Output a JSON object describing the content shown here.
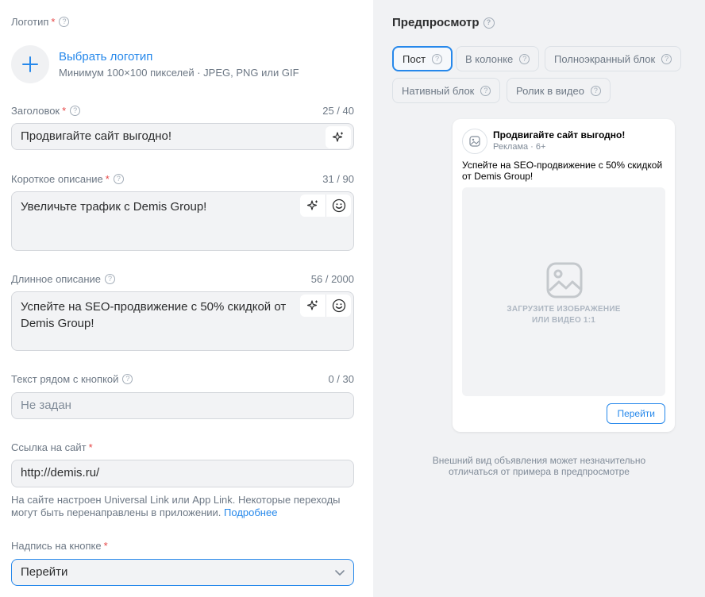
{
  "logo": {
    "label": "Логотип",
    "link": "Выбрать логотип",
    "hint": "Минимум 100×100 пикселей · JPEG, PNG или GIF"
  },
  "headline": {
    "label": "Заголовок",
    "counter": "25 / 40",
    "value": "Продвигайте сайт выгодно!"
  },
  "short_desc": {
    "label": "Короткое описание",
    "counter": "31 / 90",
    "value": "Увеличьте трафик с Demis Group!"
  },
  "long_desc": {
    "label": "Длинное описание",
    "counter": "56 / 2000",
    "value": "Успейте на SEO-продвижение с 50% скидкой от Demis Group!"
  },
  "button_text": {
    "label": "Текст рядом с кнопкой",
    "counter": "0 / 30",
    "placeholder": "Не задан"
  },
  "site_link": {
    "label": "Ссылка на сайт",
    "value": "http://demis.ru/",
    "note": "На сайте настроен Universal Link или App Link. Некоторые переходы могут быть перенаправлены в приложении.",
    "more": "Подробнее"
  },
  "cta": {
    "label": "Надпись на кнопке",
    "value": "Перейти"
  },
  "preview": {
    "title": "Предпросмотр",
    "formats": [
      "Пост",
      "В колонке",
      "Полноэкранный блок",
      "Нативный блок",
      "Ролик в видео"
    ],
    "active_format": "Пост",
    "card": {
      "title": "Продвигайте сайт выгодно!",
      "sub": "Реклама · 6+",
      "text": "Успейте на SEO-продвижение с 50% скидкой от Demis Group!",
      "media_line1": "ЗАГРУЗИТЕ ИЗОБРАЖЕНИЕ",
      "media_line2": "ИЛИ ВИДЕО 1:1",
      "button": "Перейти"
    },
    "disclaimer_line1": "Внешний вид объявления может незначительно",
    "disclaimer_line2": "отличаться от примера в предпросмотре"
  },
  "colors": {
    "accent": "#2688eb",
    "required": "#e64646",
    "panel": "#f1f2f4"
  },
  "icons": [
    "question-icon",
    "plus-icon",
    "sparkle-icon",
    "smile-icon",
    "chevron-down-icon",
    "image-icon"
  ]
}
